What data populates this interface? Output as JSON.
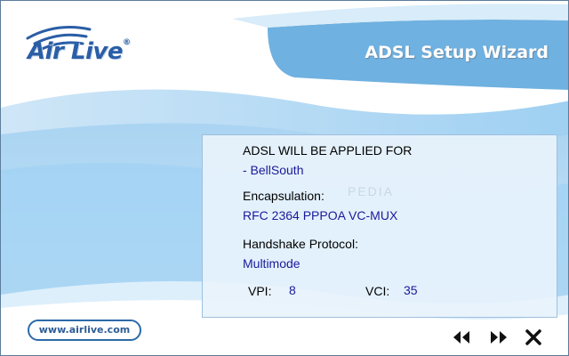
{
  "brand": {
    "logo_text": "Air Live",
    "registered_mark": "®",
    "website": "www.airlive.com"
  },
  "header": {
    "title": "ADSL Setup Wizard"
  },
  "summary": {
    "applied_for_label": "ADSL WILL BE APPLIED FOR",
    "applied_for_value": "- BellSouth",
    "encapsulation_label": "Encapsulation:",
    "encapsulation_value": "RFC 2364 PPPOA VC-MUX",
    "handshake_label": "Handshake Protocol:",
    "handshake_value": "Multimode",
    "vpi_label": "VPI:",
    "vpi_value": "8",
    "vci_label": "VCI:",
    "vci_value": "35"
  },
  "navigation": {
    "back_icon": "double-left-arrow-icon",
    "next_icon": "double-right-arrow-icon",
    "close_icon": "close-icon"
  },
  "colors": {
    "brand_blue": "#2a5ea6",
    "value_blue": "#1a1a9a",
    "wave_blue": "#8fc3ea"
  }
}
